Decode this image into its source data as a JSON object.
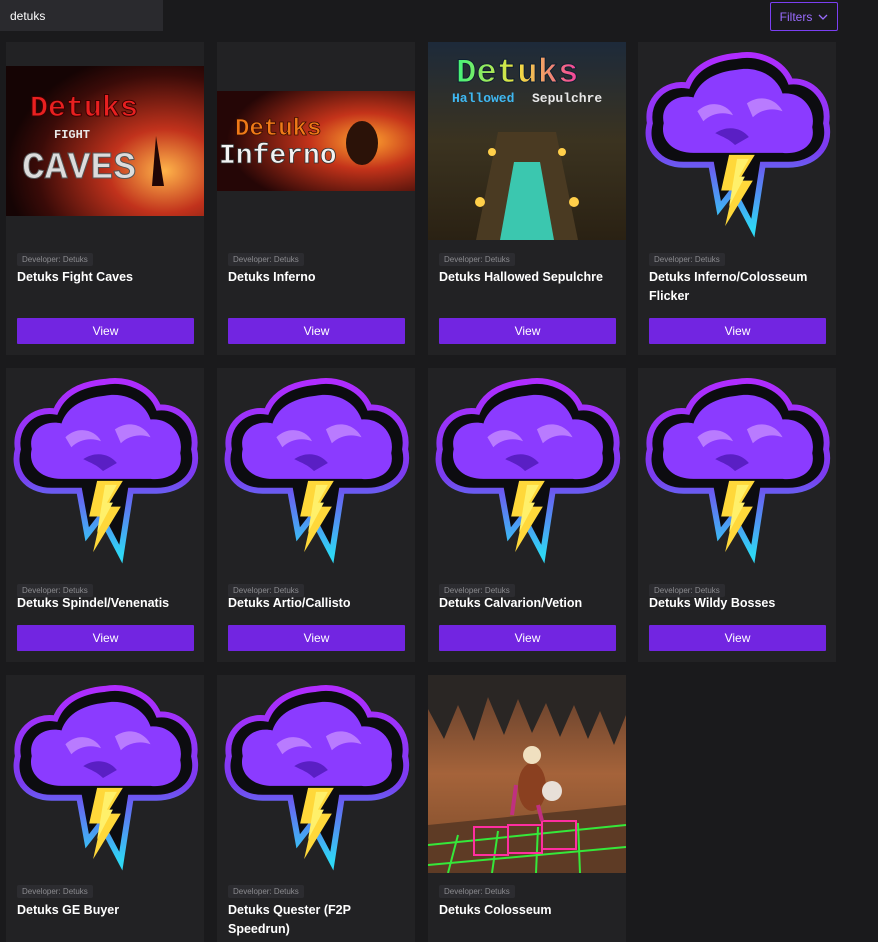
{
  "search": {
    "value": "detuks"
  },
  "filters": {
    "label": "Filters"
  },
  "colors": {
    "accent": "#7225e1",
    "card": "#222224",
    "background": "#1a1a1c"
  },
  "cards": [
    {
      "developer": "Developer: Detuks",
      "title": "Detuks Fight Caves",
      "button": "View",
      "thumb": "fight-caves-art",
      "art_title": "Detuks",
      "art_sub1": "FIGHT",
      "art_sub2": "CAVES"
    },
    {
      "developer": "Developer: Detuks",
      "title": "Detuks Inferno",
      "button": "View",
      "thumb": "inferno-art",
      "art_title": "Detuks",
      "art_sub1": "Inferno"
    },
    {
      "developer": "Developer: Detuks",
      "title": "Detuks Hallowed Sepulchre",
      "button": "View",
      "thumb": "hallowed-sepulchre-art",
      "art_title": "Detuks",
      "art_sub1": "Hallowed",
      "art_sub2": "Sepulchre"
    },
    {
      "developer": "Developer: Detuks",
      "title": "Detuks Inferno/Colosseum Flicker",
      "button": "View",
      "thumb": "storm-cloud-logo"
    },
    {
      "developer": "Developer: Detuks",
      "title": "Detuks Spindel/Venenatis",
      "button": "View",
      "thumb": "storm-cloud-logo"
    },
    {
      "developer": "Developer: Detuks",
      "title": "Detuks Artio/Callisto",
      "button": "View",
      "thumb": "storm-cloud-logo"
    },
    {
      "developer": "Developer: Detuks",
      "title": "Detuks Calvarion/Vetion",
      "button": "View",
      "thumb": "storm-cloud-logo"
    },
    {
      "developer": "Developer: Detuks",
      "title": "Detuks Wildy Bosses",
      "button": "View",
      "thumb": "storm-cloud-logo"
    },
    {
      "developer": "Developer: Detuks",
      "title": "Detuks GE Buyer",
      "button": "View",
      "thumb": "storm-cloud-logo"
    },
    {
      "developer": "Developer: Detuks",
      "title": "Detuks Quester (F2P Speedrun)",
      "button": "View",
      "thumb": "storm-cloud-logo"
    },
    {
      "developer": "Developer: Detuks",
      "title": "Detuks Colosseum",
      "button": "View",
      "thumb": "colosseum-art"
    }
  ]
}
